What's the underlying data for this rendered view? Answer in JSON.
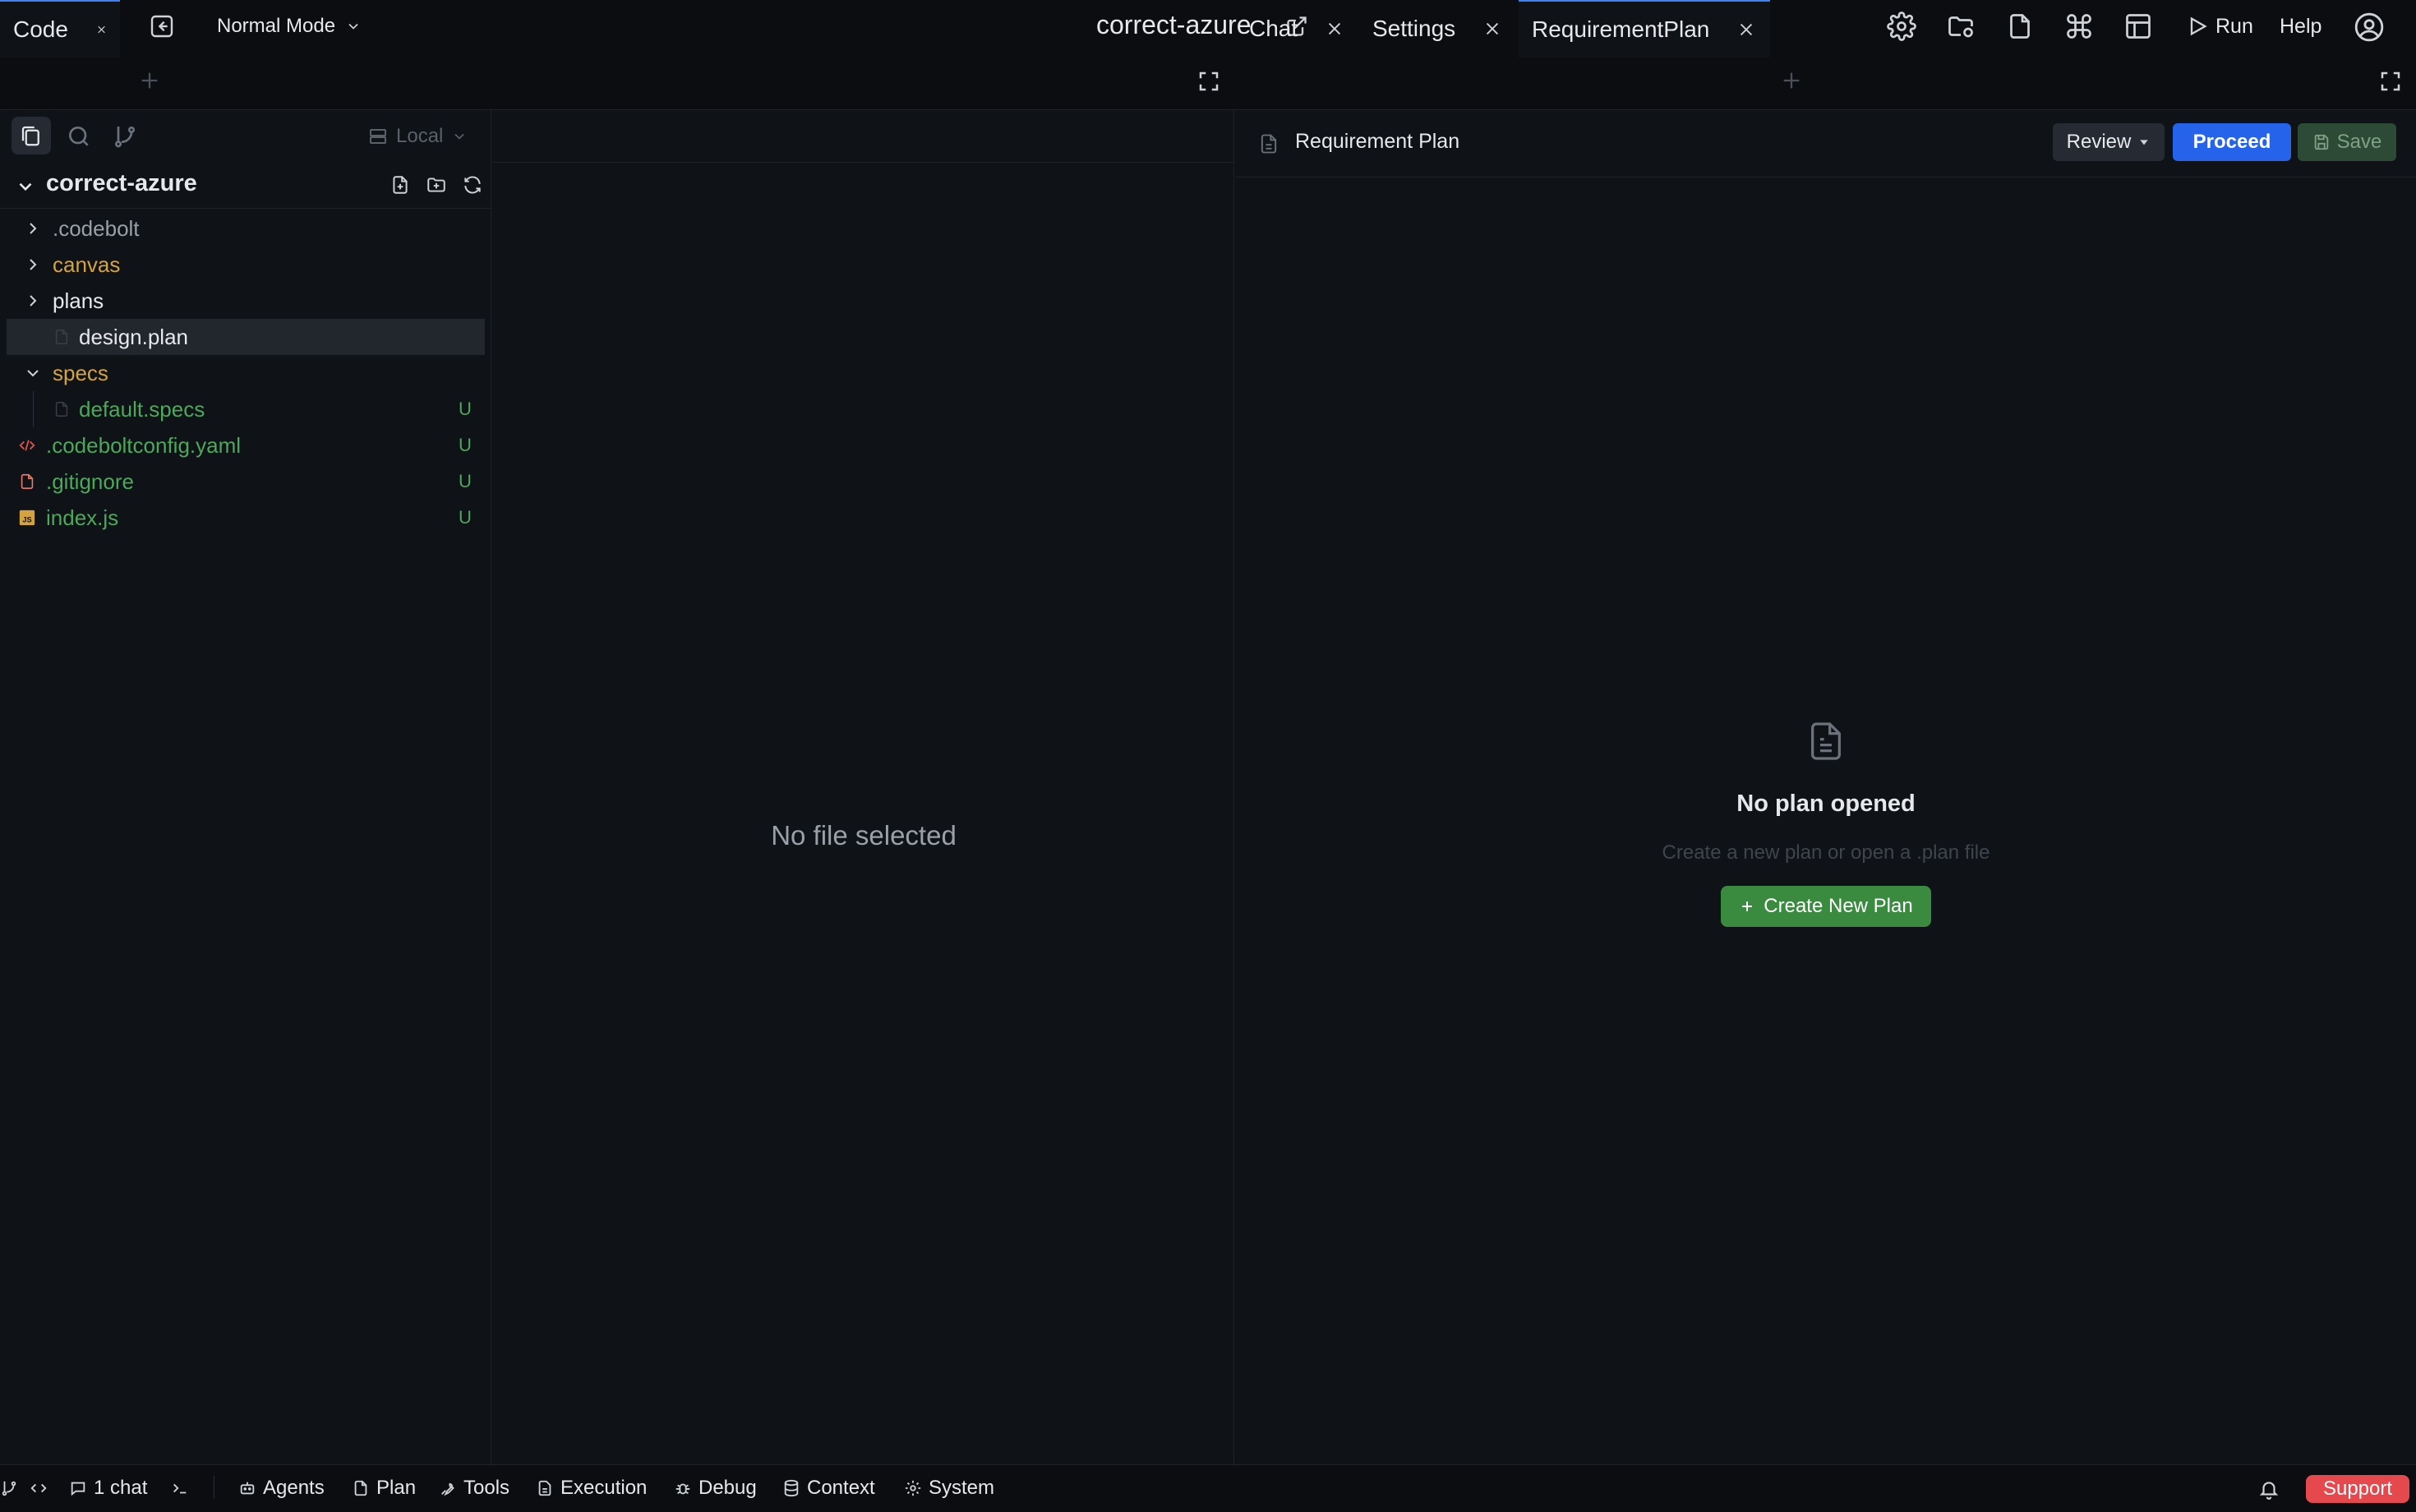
{
  "topbar": {
    "mode_label": "Normal Mode",
    "project_title": "correct-azure",
    "run_label": "Run",
    "help_label": "Help"
  },
  "tabs": {
    "left": [
      {
        "label": "Code"
      }
    ],
    "right": [
      {
        "label": "Chat"
      },
      {
        "label": "Settings"
      },
      {
        "label": "RequirementPlan"
      }
    ]
  },
  "explorer": {
    "local_label": "Local",
    "project_name": "correct-azure",
    "items": [
      {
        "name": ".codebolt",
        "type": "folder",
        "color": "#9aa0a8",
        "badge": ""
      },
      {
        "name": "canvas",
        "type": "folder",
        "color": "#d4a341",
        "badge": ""
      },
      {
        "name": "plans",
        "type": "folder",
        "color": "#e6e8eb",
        "badge": ""
      },
      {
        "name": "design.plan",
        "type": "file",
        "color": "#e6e8eb",
        "badge": ""
      },
      {
        "name": "specs",
        "type": "folder",
        "color": "#d4a341",
        "badge": ""
      },
      {
        "name": "default.specs",
        "type": "file",
        "color": "#4ca85a",
        "badge": "U"
      },
      {
        "name": ".codeboltconfig.yaml",
        "type": "file",
        "color": "#4ca85a",
        "badge": "U"
      },
      {
        "name": ".gitignore",
        "type": "file",
        "color": "#4ca85a",
        "badge": "U"
      },
      {
        "name": "index.js",
        "type": "file",
        "color": "#4ca85a",
        "badge": "U"
      }
    ]
  },
  "editor": {
    "empty_text": "No file selected"
  },
  "plan": {
    "header_title": "Requirement Plan",
    "review_label": "Review",
    "proceed_label": "Proceed",
    "save_label": "Save",
    "empty_title": "No plan opened",
    "empty_subtitle": "Create a new plan or open a .plan file",
    "create_label": "Create New Plan"
  },
  "statusbar": {
    "chat_count": "1 chat",
    "items": [
      "Agents",
      "Plan",
      "Tools",
      "Execution",
      "Debug",
      "Context",
      "System"
    ],
    "support_label": "Support"
  },
  "colors": {
    "accent": "#3b82f6",
    "proceed": "#2563eb",
    "create": "#3a8a3f",
    "support": "#e5484d",
    "untracked": "#4ca85a",
    "folder_modified": "#d4a341"
  }
}
